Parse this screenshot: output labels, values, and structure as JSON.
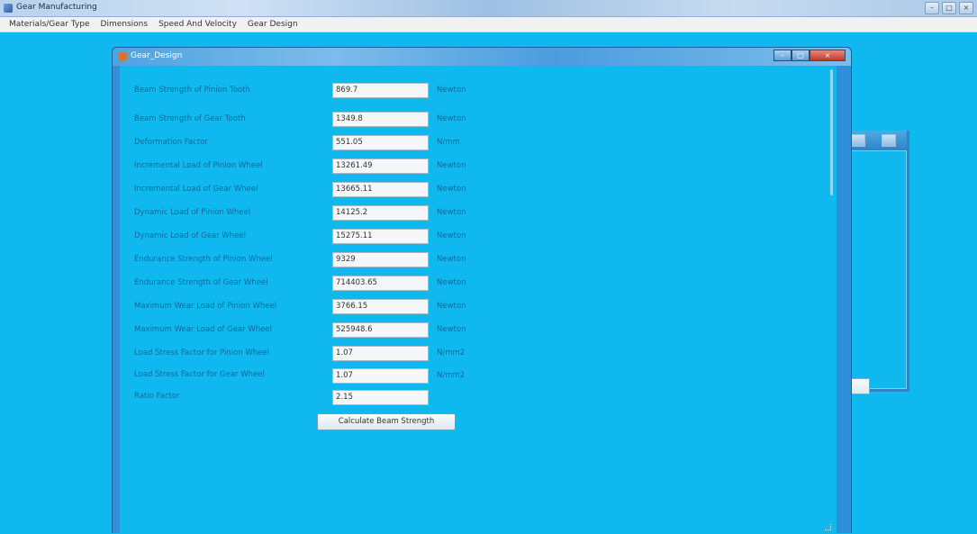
{
  "window": {
    "title": "Gear Manufacturing"
  },
  "menu": [
    {
      "label": "Materials/Gear Type"
    },
    {
      "label": "Dimensions"
    },
    {
      "label": "Speed And Velocity"
    },
    {
      "label": "Gear Design"
    }
  ],
  "child_window": {
    "title": "Gear_Design",
    "rows": [
      {
        "label": "Beam Strength of Pinion Tooth",
        "value": "869.7",
        "unit": "Newton"
      },
      {
        "label": "Beam Strength of Gear Tooth",
        "value": "1349.8",
        "unit": "Newton"
      },
      {
        "label": "Deformation Factor",
        "value": "551.05",
        "unit": "N/mm"
      },
      {
        "label": "Incremental Load of Pinion Wheel",
        "value": "13261.49",
        "unit": "Newton"
      },
      {
        "label": "Incremental Load of Gear Wheel",
        "value": "13665.11",
        "unit": "Newton"
      },
      {
        "label": "Dynamic Load of Pinion Wheel",
        "value": "14125.2",
        "unit": "Newton"
      },
      {
        "label": "Dynamic Load of Gear Wheel",
        "value": "15275.11",
        "unit": "Newton"
      },
      {
        "label": "Endurance Strength of Pinion Wheel",
        "value": "9329",
        "unit": "Newton"
      },
      {
        "label": "Endurance Strength of Gear Wheel",
        "value": "714403.65",
        "unit": "Newton"
      },
      {
        "label": "Maximum Wear Load of Pinion Wheel",
        "value": "3766.15",
        "unit": "Newton"
      },
      {
        "label": "Maximum Wear Load of Gear Wheel",
        "value": "525948.6",
        "unit": "Newton"
      },
      {
        "label": "Load Stress Factor for Pinion Wheel",
        "value": "1.07",
        "unit": "N/mm2"
      },
      {
        "label": "Load Stress Factor for Gear Wheel",
        "value": "1.07",
        "unit": "N/mm2"
      },
      {
        "label": "Ratio Factor",
        "value": "2.15",
        "unit": ""
      }
    ],
    "calculate_button": "Calculate Beam Strength"
  },
  "colors": {
    "background": "#10b8f0",
    "label_text": "#0a6a9c",
    "titlebar": "#2f8fd8"
  }
}
